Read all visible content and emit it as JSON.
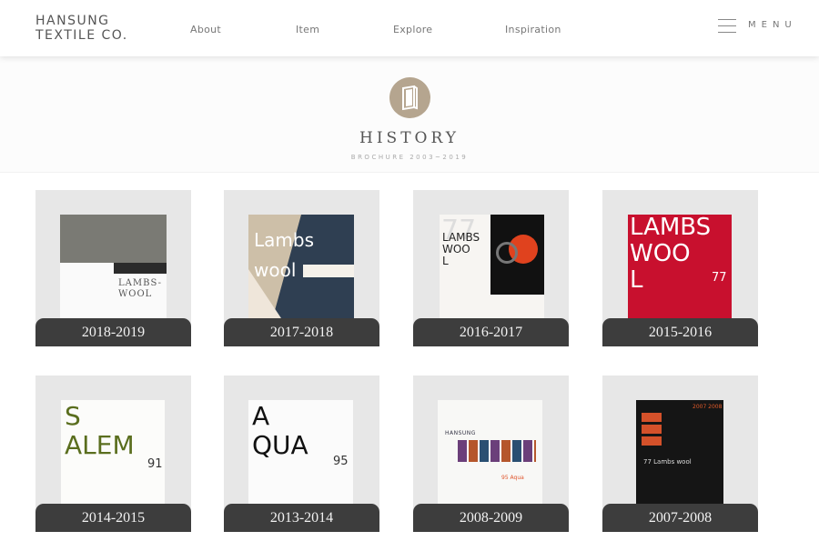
{
  "brand": {
    "line1": "HANSUNG",
    "line2": "TEXTILE CO."
  },
  "nav": [
    {
      "label": "About"
    },
    {
      "label": "Item"
    },
    {
      "label": "Explore"
    },
    {
      "label": "Inspiration"
    }
  ],
  "menu": {
    "label": "MENU"
  },
  "hero": {
    "icon": "book-icon",
    "title": "HISTORY",
    "subtitle": "BROCHURE 2003~2019"
  },
  "items": [
    {
      "label": "2018-2019",
      "cover_lines": [
        "LAMBS-",
        "WOOL"
      ]
    },
    {
      "label": "2017-2018",
      "cover_lines": [
        "Lambs",
        "wool"
      ]
    },
    {
      "label": "2016-2017",
      "cover_lines": [
        "LAMBS",
        "WOO",
        "L",
        "77"
      ]
    },
    {
      "label": "2015-2016",
      "cover_lines": [
        "LAMBS",
        "WOO",
        "L",
        "77"
      ]
    },
    {
      "label": "2014-2015",
      "cover_lines": [
        "S",
        "ALEM",
        "91"
      ]
    },
    {
      "label": "2013-2014",
      "cover_lines": [
        "A",
        "QUA",
        "95"
      ]
    },
    {
      "label": "2008-2009",
      "cover_lines": [
        "HANSUNG",
        "95 Aqua"
      ]
    },
    {
      "label": "2007-2008",
      "cover_lines": [
        "2007 2008",
        "77 Lambs wool"
      ]
    }
  ]
}
